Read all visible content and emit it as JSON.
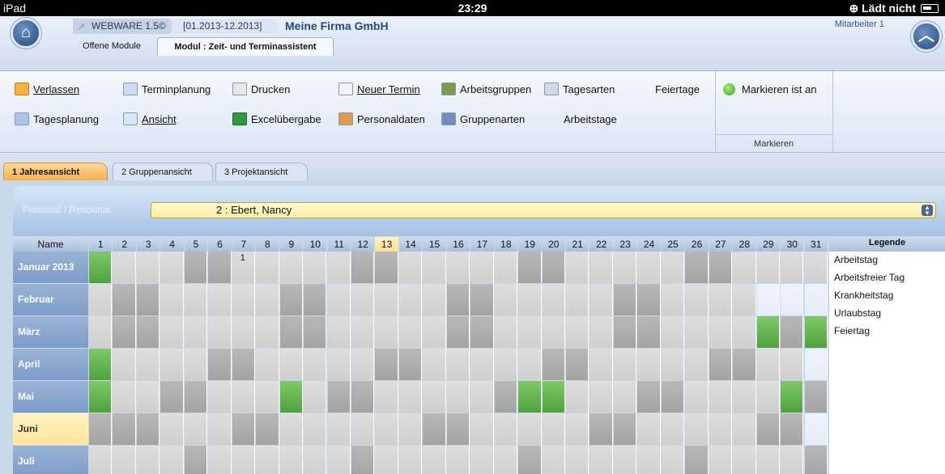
{
  "status": {
    "device": "iPad",
    "time": "23:29",
    "charging": "Lädt nicht"
  },
  "header": {
    "app": "WEBWARE 1.5©",
    "period": "[01.2013-12.2013]",
    "company": "Meine Firma GmbH",
    "employee": "Mitarbeiter 1",
    "tabs": [
      "Offene Module",
      "Modul : Zeit- und Terminassistent"
    ]
  },
  "ribbon": {
    "verlassen": "Verlassen",
    "tagesplanung": "Tagesplanung",
    "terminplanung": "Terminplanung",
    "ansicht": "Ansicht",
    "drucken": "Drucken",
    "excel": "Excelübergabe",
    "neuer_termin": "Neuer Termin",
    "personaldaten": "Personaldaten",
    "arbeitsgruppen": "Arbeitsgruppen",
    "gruppenarten": "Gruppenarten",
    "tagesarten": "Tagesarten",
    "arbeitstage": "Arbeitstage",
    "feiertage": "Feiertage",
    "markieren_toggle": "Markieren ist an",
    "markieren_group": "Markieren"
  },
  "view_tabs": {
    "t1": "1 Jahresansicht",
    "t2": "2 Gruppenansicht",
    "t3": "3 Projektansicht"
  },
  "resource": {
    "label": "Personal / Resource",
    "value": "2  : Ebert, Nancy"
  },
  "calendar": {
    "name_header": "Name",
    "days": [
      "1",
      "2",
      "3",
      "4",
      "5",
      "6",
      "7",
      "8",
      "9",
      "10",
      "11",
      "12",
      "13",
      "14",
      "15",
      "16",
      "17",
      "18",
      "19",
      "20",
      "21",
      "22",
      "23",
      "24",
      "25",
      "26",
      "27",
      "28",
      "29",
      "30",
      "31"
    ],
    "highlight_day": 13,
    "months": [
      "Januar 2013",
      "Februar",
      "März",
      "April",
      "Mai",
      "Juni",
      "Juli"
    ],
    "selected_month": "Juni",
    "rows": [
      [
        3,
        0,
        0,
        0,
        1,
        1,
        0,
        0,
        0,
        0,
        0,
        1,
        1,
        0,
        0,
        0,
        0,
        0,
        1,
        1,
        0,
        0,
        0,
        0,
        0,
        1,
        1,
        0,
        0,
        0,
        0
      ],
      [
        0,
        1,
        1,
        0,
        0,
        0,
        0,
        0,
        1,
        1,
        0,
        0,
        0,
        0,
        0,
        1,
        1,
        0,
        0,
        0,
        0,
        0,
        1,
        1,
        0,
        0,
        0,
        0,
        4,
        4,
        4
      ],
      [
        0,
        1,
        1,
        0,
        0,
        0,
        0,
        0,
        1,
        1,
        0,
        0,
        0,
        0,
        0,
        1,
        1,
        0,
        0,
        0,
        0,
        0,
        1,
        1,
        0,
        0,
        0,
        0,
        3,
        1,
        3
      ],
      [
        3,
        0,
        0,
        0,
        0,
        1,
        1,
        0,
        0,
        0,
        0,
        0,
        1,
        1,
        0,
        0,
        0,
        0,
        0,
        1,
        1,
        0,
        0,
        0,
        0,
        0,
        1,
        1,
        0,
        0,
        4
      ],
      [
        3,
        0,
        0,
        1,
        1,
        0,
        0,
        0,
        3,
        0,
        1,
        1,
        0,
        0,
        0,
        0,
        0,
        1,
        3,
        3,
        0,
        0,
        0,
        1,
        1,
        0,
        0,
        0,
        0,
        3,
        1
      ],
      [
        1,
        1,
        1,
        0,
        0,
        0,
        1,
        1,
        0,
        0,
        0,
        0,
        0,
        0,
        1,
        1,
        0,
        0,
        0,
        0,
        0,
        1,
        1,
        0,
        0,
        0,
        0,
        0,
        1,
        1,
        4
      ],
      [
        0,
        0,
        0,
        0,
        1,
        0,
        0,
        0,
        0,
        0,
        0,
        1,
        0,
        0,
        0,
        0,
        0,
        0,
        1,
        0,
        0,
        0,
        0,
        0,
        0,
        1,
        0,
        0,
        0,
        0,
        1
      ]
    ],
    "annotation": {
      "month": 0,
      "day": 7,
      "text": "1"
    }
  },
  "legend": {
    "title": "Legende",
    "items": [
      "Arbeitstag",
      "Arbeitsfreier Tag",
      "Krankheitstag",
      "Urlaubstag",
      "Feiertag"
    ]
  }
}
